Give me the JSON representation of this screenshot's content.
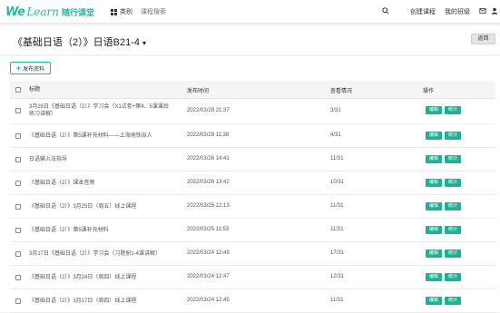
{
  "header": {
    "logo_we": "We",
    "logo_learn": "Learn",
    "logo_cn": "随行课堂",
    "category_label": "类别",
    "search_placeholder": "课程搜索",
    "create_course": "创建课程",
    "my_classes": "我的班级"
  },
  "page": {
    "title": "《基础日语（2）》日语B21-4",
    "title_arrow": "▾",
    "back_label": "返回",
    "publish_label": "发布资料"
  },
  "table": {
    "headers": {
      "title": "标题",
      "time": "发布时间",
      "views": "查看情况",
      "ops": "操作"
    },
    "edit_label": "编辑",
    "stats_label": "统计",
    "rows": [
      {
        "title": "3月28日《基础日语（2）》学习会（X1试卷+第4、5课课后练习讲解）",
        "time": "2022/03/28 21:37",
        "views": "3/31"
      },
      {
        "title": "《基础日语（2）》第5课补充材料——上海地铁拟人",
        "time": "2022/03/28 11:38",
        "views": "4/31"
      },
      {
        "title": "日语输入法指导",
        "time": "2022/03/26 14:41",
        "views": "11/31"
      },
      {
        "title": "《基础日语（2）》课本音频",
        "time": "2022/03/26 13:42",
        "views": "10/31"
      },
      {
        "title": "《基础日语（2）》3月25日（周五）线上课程",
        "time": "2022/03/25 12:13",
        "views": "11/31"
      },
      {
        "title": "《基础日语（2）》第5课补充材料",
        "time": "2022/03/25 11:53",
        "views": "11/31"
      },
      {
        "title": "3月17日《基础日语（2）》学习会（习题册1-4课讲解）",
        "time": "2022/03/24 12:49",
        "views": "17/31"
      },
      {
        "title": "《基础日语（2）》3月24日（周四）线上课程",
        "time": "2022/03/24 12:47",
        "views": "12/31"
      },
      {
        "title": "《基础日语（2）》3月17日（周四）线上课程",
        "time": "2022/03/24 12:45",
        "views": "11/31"
      }
    ]
  }
}
